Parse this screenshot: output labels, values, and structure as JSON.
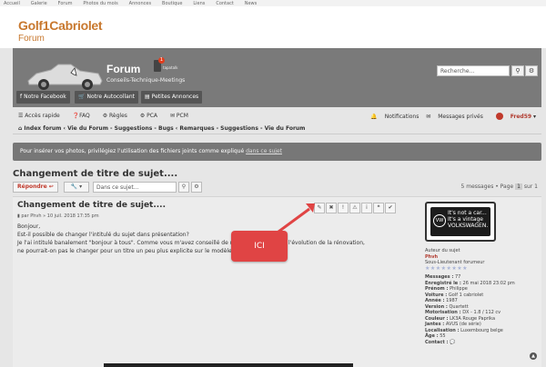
{
  "topnav": {
    "items": [
      "Accueil",
      "Galerie",
      "Forum",
      "Photos du mois",
      "Annonces",
      "Boutique",
      "Liens",
      "Contact",
      "News"
    ]
  },
  "site": {
    "title": "Golf1Cabriolet",
    "subtitle": "Forum"
  },
  "banner": {
    "forum_label": "Forum",
    "tagline": "Conseils-Technique-Meetings",
    "tapatalk_badge": "1",
    "tapatalk_label": "tapatalk",
    "search_placeholder": "Recherche…",
    "buttons": [
      "Notre Facebook",
      "Notre Autocollant",
      "Petites Annonces"
    ]
  },
  "navbar": {
    "links": [
      "Accès rapide",
      "FAQ",
      "Règles",
      "PCA",
      "PCM"
    ],
    "notifications": "Notifications",
    "messages": "Messages privés",
    "user": "Fred59",
    "breadcrumb": "Index forum ‹ Vie du Forum - Suggestions - Bugs ‹ Remarques - Suggestions - Vie du Forum"
  },
  "notice": {
    "text": "Pour insérer vos photos, privilégiez l'utilisation des fichiers joints comme expliqué",
    "link": "dans ce sujet"
  },
  "topic": {
    "title": "Changement de titre de sujet....",
    "reply_label": "Répondre",
    "search_placeholder": "Dans ce sujet…",
    "pagination": "5 messages • Page",
    "page_current": "1",
    "page_suffix": "sur 1"
  },
  "post": {
    "title": "Changement de titre de sujet....",
    "meta": "par Phvh » 10 juil. 2018 17:35 pm",
    "lines": [
      "Bonjour,",
      "Est-il possible de changer l'intitulé du sujet dans présentation?",
      "Je l'ai intitulé banalement \"bonjour à tous\". Comme vous m'avez conseillé de mettre les photos de l'évolution de la rénovation,",
      "ne pourrait-on pas le changer pour un titre un peu plus explicite sur le modèle"
    ]
  },
  "sticker": {
    "text": "It's not a car... It's a vintage VOLKSWAGEN.",
    "logo": "VW"
  },
  "profile": {
    "role": "Auteur du sujet",
    "name": "Phvh",
    "rank": "Sous-Lieutenant forumeur",
    "fields": [
      {
        "k": "Messages :",
        "v": "77"
      },
      {
        "k": "Enregistré le :",
        "v": "26 mai 2018 23:02 pm"
      },
      {
        "k": "Prénom :",
        "v": "Philippe"
      },
      {
        "k": "Voiture :",
        "v": "Golf 1 cabriolet"
      },
      {
        "k": "Année :",
        "v": "1987"
      },
      {
        "k": "Version :",
        "v": "Quartett"
      },
      {
        "k": "Motorisation :",
        "v": "DX - 1.8 / 112 cv"
      },
      {
        "k": "Couleur :",
        "v": "LK3A Rouge Paprika"
      },
      {
        "k": "Jantes :",
        "v": "AVUS (de série)"
      },
      {
        "k": "Localisation :",
        "v": "Luxembourg belge"
      },
      {
        "k": "Âge :",
        "v": "55"
      },
      {
        "k": "Contact :",
        "v": ""
      }
    ]
  },
  "callout": {
    "text": "ICI"
  },
  "colors": {
    "brand": "#c8782e",
    "banner": "#7a7a7a",
    "callout": "#e04444",
    "user": "#b03a2e"
  }
}
